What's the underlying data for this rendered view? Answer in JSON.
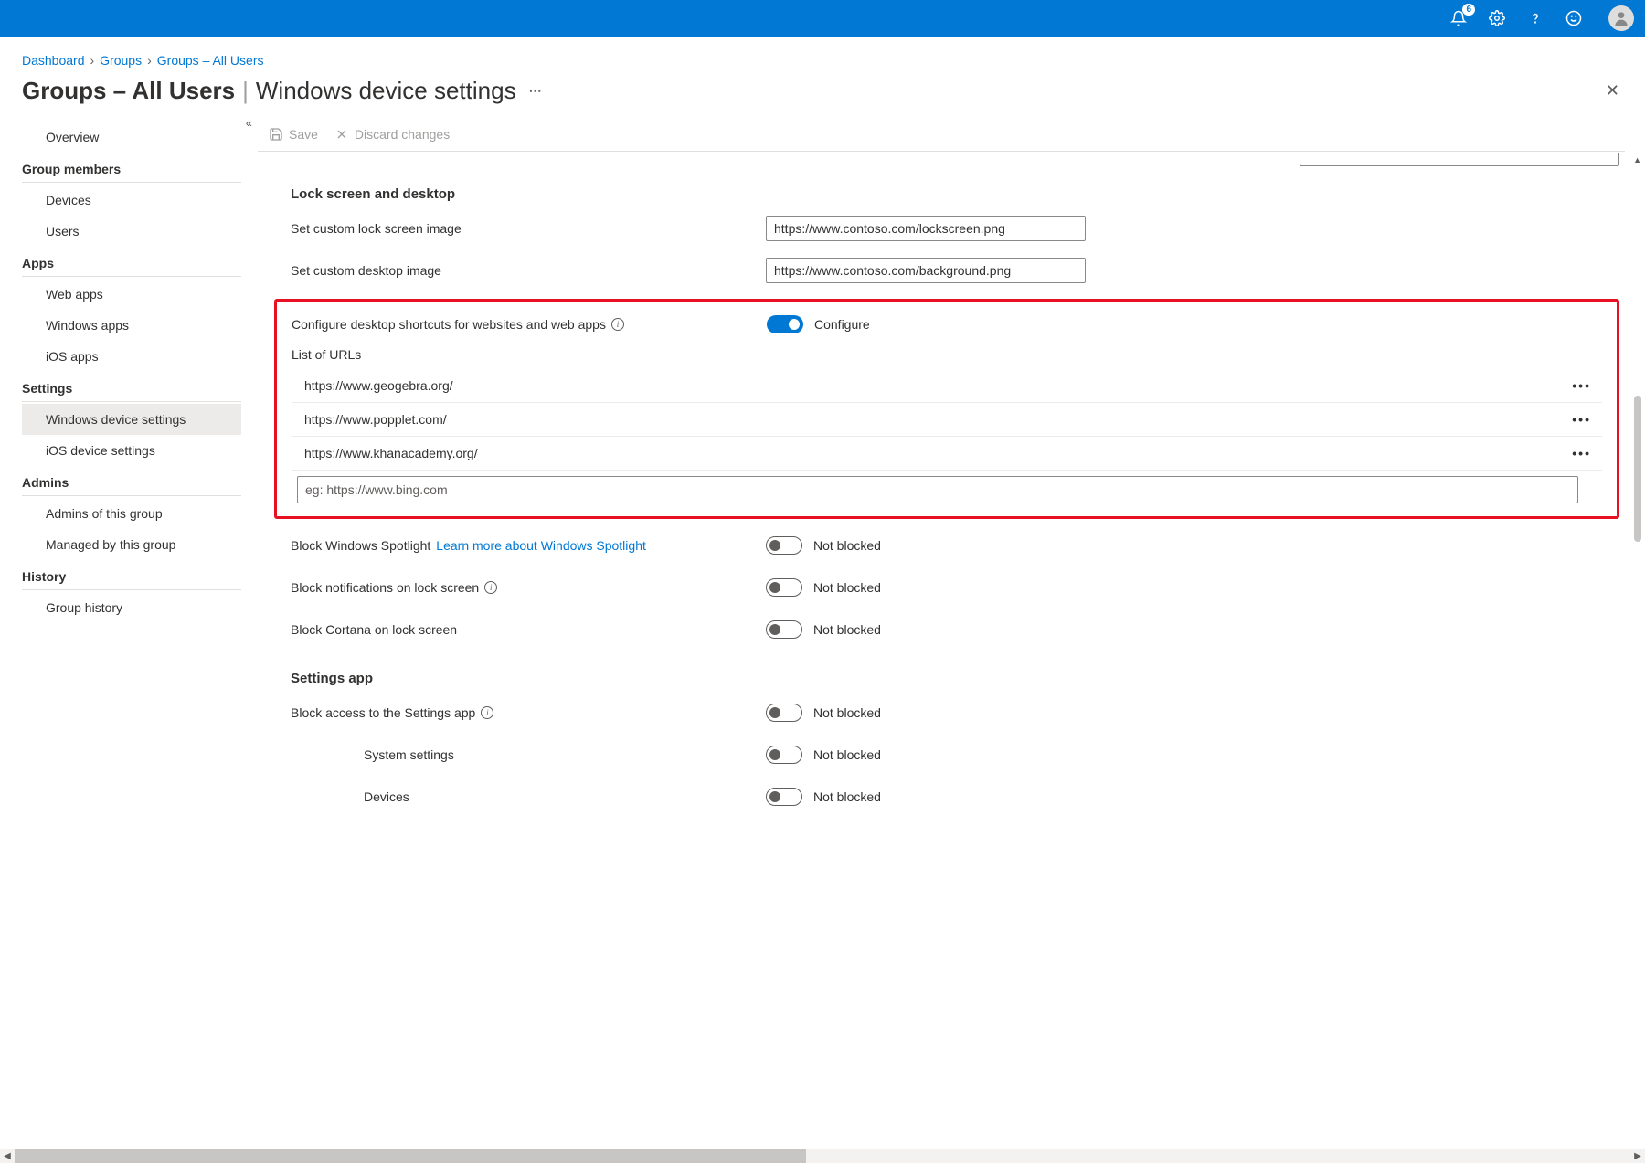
{
  "topbar": {
    "notif_count": "6"
  },
  "breadcrumb": {
    "a": "Dashboard",
    "b": "Groups",
    "c": "Groups – All Users"
  },
  "title": {
    "main": "Groups – All Users",
    "sub": "Windows device settings"
  },
  "toolbar": {
    "save": "Save",
    "discard": "Discard changes"
  },
  "sidebar": {
    "overview": "Overview",
    "sec_members": "Group members",
    "devices": "Devices",
    "users": "Users",
    "sec_apps": "Apps",
    "webapps": "Web apps",
    "winapps": "Windows apps",
    "iosapps": "iOS apps",
    "sec_settings": "Settings",
    "winset": "Windows device settings",
    "iosset": "iOS device settings",
    "sec_admins": "Admins",
    "admins_of": "Admins of this group",
    "managed_by": "Managed by this group",
    "sec_history": "History",
    "grp_history": "Group history"
  },
  "sec1": {
    "h": "Lock screen and desktop",
    "lock_label": "Set custom lock screen image",
    "lock_val": "https://www.contoso.com/lockscreen.png",
    "desk_label": "Set custom desktop image",
    "desk_val": "https://www.contoso.com/background.png",
    "cfg_label": "Configure desktop shortcuts for websites and web apps",
    "cfg_state": "Configure",
    "list_label": "List of URLs",
    "urls": {
      "u0": "https://www.geogebra.org/",
      "u1": "https://www.popplet.com/",
      "u2": "https://www.khanacademy.org/"
    },
    "url_ph": "eg: https://www.bing.com",
    "spot_label": "Block Windows Spotlight",
    "spot_link": "Learn more about Windows Spotlight",
    "notif_label": "Block notifications on lock screen",
    "cortana_label": "Block Cortana on lock screen",
    "not_blocked": "Not blocked"
  },
  "sec2": {
    "h": "Settings app",
    "block_label": "Block access to the Settings app",
    "sys": "System settings",
    "dev": "Devices",
    "not_blocked": "Not blocked"
  }
}
